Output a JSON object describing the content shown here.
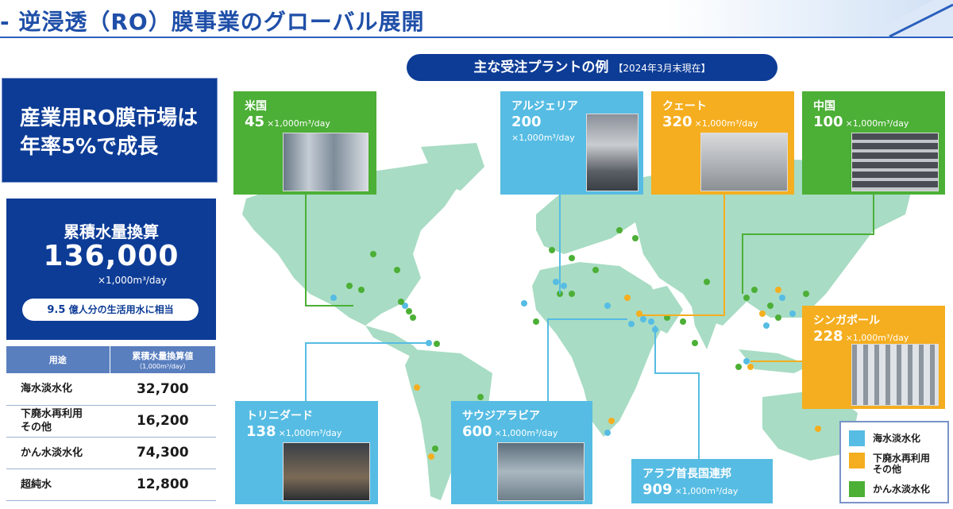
{
  "header": {
    "title": "- 逆浸透（RO）膜事業のグローバル展開"
  },
  "growth": {
    "line1": "産業用RO膜市場は",
    "line2": "年率5%で成長"
  },
  "cumulative": {
    "title": "累積水量換算",
    "value": "136,000",
    "unit": "×1,000m³/day",
    "pill_num": "9.5",
    "pill_text": " 億人分の生活用水に相当"
  },
  "usage_table": {
    "headers": [
      "用途",
      "累積水量換算値"
    ],
    "header_sub": "（1,000m³/day）",
    "rows": [
      {
        "label": "海水淡水化",
        "value": "32,700"
      },
      {
        "label": "下廃水再利用\nその他",
        "label1": "下廃水再利用",
        "label2": "その他",
        "value": "16,200"
      },
      {
        "label": "かん水淡水化",
        "value": "74,300"
      },
      {
        "label": "超純水",
        "value": "12,800"
      }
    ]
  },
  "map": {
    "title": "主な受注プラントの例",
    "date": "【2024年3月末現在】"
  },
  "plants": [
    {
      "name": "米国",
      "capacity": "45",
      "unit": "×1,000m³/day",
      "category": "brackish"
    },
    {
      "name": "アルジェリア",
      "capacity": "200",
      "unit": "×1,000m³/day",
      "category": "seawater"
    },
    {
      "name": "クェート",
      "capacity": "320",
      "unit": "×1,000m³/day",
      "category": "reuse"
    },
    {
      "name": "中国",
      "capacity": "100",
      "unit": "×1,000m³/day",
      "category": "brackish"
    },
    {
      "name": "シンガポール",
      "capacity": "228",
      "unit": "×1,000m³/day",
      "category": "reuse"
    },
    {
      "name": "トリニダード",
      "capacity": "138",
      "unit": "×1,000m³/day",
      "category": "seawater"
    },
    {
      "name": "サウジアラビア",
      "capacity": "600",
      "unit": "×1,000m³/day",
      "category": "seawater"
    },
    {
      "name": "アラブ首長国連邦",
      "capacity": "909",
      "unit": "×1,000m³/day",
      "category": "seawater"
    }
  ],
  "legend": {
    "items": [
      {
        "label": "海水淡水化",
        "color": "#56bce3"
      },
      {
        "label": "下廃水再利用\nその他",
        "label1": "下廃水再利用",
        "label2": "その他",
        "color": "#f5ae1f"
      },
      {
        "label": "かん水淡水化",
        "color": "#4caf36"
      }
    ]
  },
  "colors": {
    "navy": "#0d3c96",
    "seawater": "#56bce3",
    "reuse": "#f5ae1f",
    "brackish": "#4caf36",
    "land": "#a8dcc4"
  }
}
